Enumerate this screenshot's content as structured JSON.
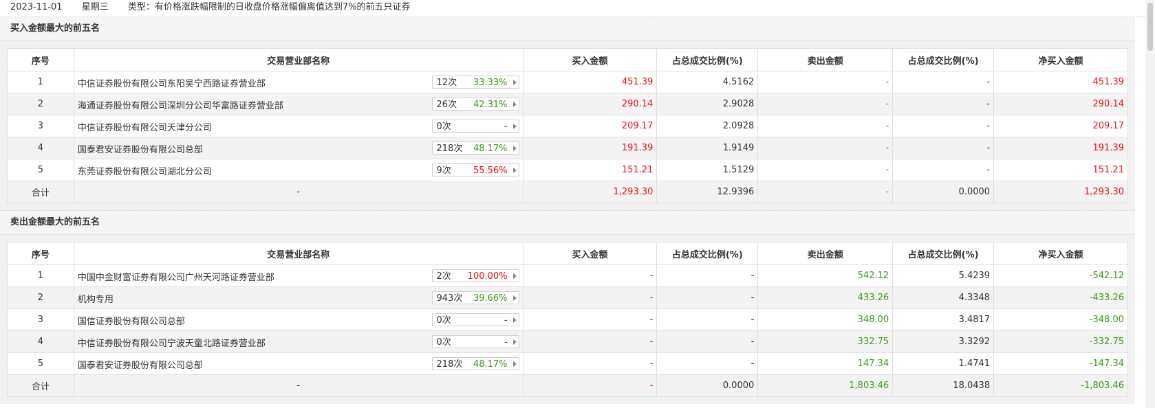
{
  "topbar": {
    "date": "2023-11-01",
    "weekday": "星期三",
    "type_text": "类型：有价格涨跌幅限制的日收盘价格涨幅偏离值达到7%的前五只证券"
  },
  "colors": {
    "up": "#e8101a",
    "down": "#3b9a1a"
  },
  "headers": [
    "序号",
    "交易营业部名称",
    "买入金额",
    "占总成交比例(%)",
    "卖出金额",
    "占总成交比例(%)",
    "净买入金额"
  ],
  "buy_section": {
    "title": "买入金额最大的前五名",
    "rows": [
      {
        "no": "1",
        "name": "中信证券股份有限公司东阳吴宁西路证券营业部",
        "times": "12次",
        "rate": "33.33%",
        "rate_color": "green",
        "buy": "451.39",
        "buy_pct": "4.5162",
        "sell": "-",
        "sell_pct": "-",
        "net": "451.39"
      },
      {
        "no": "2",
        "name": "海通证券股份有限公司深圳分公司华富路证券营业部",
        "times": "26次",
        "rate": "42.31%",
        "rate_color": "green",
        "buy": "290.14",
        "buy_pct": "2.9028",
        "sell": "-",
        "sell_pct": "-",
        "net": "290.14"
      },
      {
        "no": "3",
        "name": "中信证券股份有限公司天津分公司",
        "times": "0次",
        "rate": "-",
        "rate_color": "plain",
        "buy": "209.17",
        "buy_pct": "2.0928",
        "sell": "-",
        "sell_pct": "-",
        "net": "209.17"
      },
      {
        "no": "4",
        "name": "国泰君安证券股份有限公司总部",
        "times": "218次",
        "rate": "48.17%",
        "rate_color": "green",
        "buy": "191.39",
        "buy_pct": "1.9149",
        "sell": "-",
        "sell_pct": "-",
        "net": "191.39"
      },
      {
        "no": "5",
        "name": "东莞证券股份有限公司湖北分公司",
        "times": "9次",
        "rate": "55.56%",
        "rate_color": "red",
        "buy": "151.21",
        "buy_pct": "1.5129",
        "sell": "-",
        "sell_pct": "-",
        "net": "151.21"
      }
    ],
    "total": {
      "label": "合计",
      "name": "-",
      "buy": "1,293.30",
      "buy_pct": "12.9396",
      "sell": "-",
      "sell_pct": "0.0000",
      "net": "1,293.30"
    }
  },
  "sell_section": {
    "title": "卖出金额最大的前五名",
    "rows": [
      {
        "no": "1",
        "name": "中国中金财富证券有限公司广州天河路证券营业部",
        "times": "2次",
        "rate": "100.00%",
        "rate_color": "red",
        "buy": "-",
        "buy_pct": "-",
        "sell": "542.12",
        "sell_pct": "5.4239",
        "net": "-542.12"
      },
      {
        "no": "2",
        "name": "机构专用",
        "times": "943次",
        "rate": "39.66%",
        "rate_color": "green",
        "buy": "-",
        "buy_pct": "-",
        "sell": "433.26",
        "sell_pct": "4.3348",
        "net": "-433.26"
      },
      {
        "no": "3",
        "name": "国信证券股份有限公司总部",
        "times": "0次",
        "rate": "-",
        "rate_color": "plain",
        "buy": "-",
        "buy_pct": "-",
        "sell": "348.00",
        "sell_pct": "3.4817",
        "net": "-348.00"
      },
      {
        "no": "4",
        "name": "中信证券股份有限公司宁波天童北路证券营业部",
        "times": "0次",
        "rate": "-",
        "rate_color": "plain",
        "buy": "-",
        "buy_pct": "-",
        "sell": "332.75",
        "sell_pct": "3.3292",
        "net": "-332.75"
      },
      {
        "no": "5",
        "name": "国泰君安证券股份有限公司总部",
        "times": "218次",
        "rate": "48.17%",
        "rate_color": "green",
        "buy": "-",
        "buy_pct": "-",
        "sell": "147.34",
        "sell_pct": "1.4741",
        "net": "-147.34"
      }
    ],
    "total": {
      "label": "合计",
      "name": "-",
      "buy": "-",
      "buy_pct": "0.0000",
      "sell": "1,803.46",
      "sell_pct": "18.0438",
      "net": "-1,803.46"
    }
  }
}
